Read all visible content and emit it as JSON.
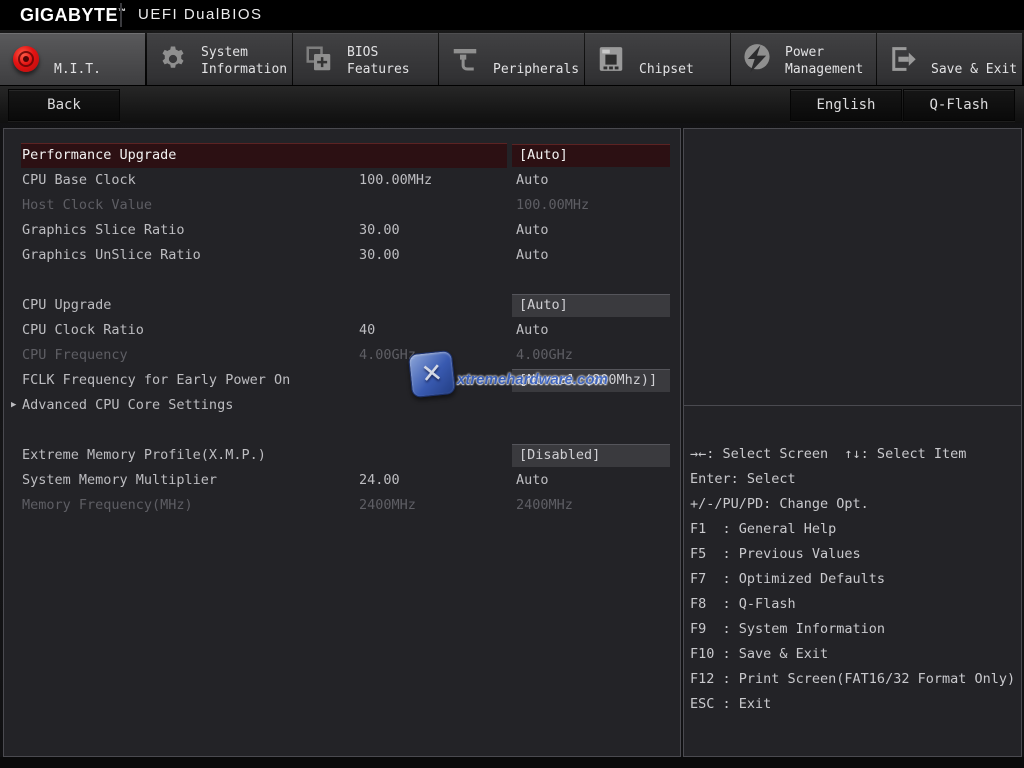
{
  "header": {
    "logo": "GIGABYTE",
    "logo_tm": "™",
    "title": "UEFI DualBIOS"
  },
  "tabs": [
    {
      "label": "M.I.T.",
      "icon": "mit-red-dot-icon",
      "active": true
    },
    {
      "label": "System Information",
      "icon": "gear-icon",
      "active": false
    },
    {
      "label": "BIOS Features",
      "icon": "bios-chip-icon",
      "active": false
    },
    {
      "label": "Peripherals",
      "icon": "peripherals-icon",
      "active": false
    },
    {
      "label": "Chipset",
      "icon": "chipset-icon",
      "active": false
    },
    {
      "label": "Power Management",
      "icon": "power-bolt-icon",
      "active": false
    },
    {
      "label": "Save & Exit",
      "icon": "exit-door-icon",
      "active": false
    }
  ],
  "toolbar": {
    "back": "Back",
    "language": "English",
    "qflash": "Q-Flash"
  },
  "settings": {
    "rows": [
      {
        "label": "Performance Upgrade",
        "col2": "",
        "value": "[Auto]",
        "selected": true,
        "boxed": true
      },
      {
        "label": "CPU Base Clock",
        "col2": "100.00MHz",
        "value": "Auto"
      },
      {
        "label": "Host Clock Value",
        "col2": "",
        "value": "100.00MHz",
        "dim": true
      },
      {
        "label": "Graphics Slice Ratio",
        "col2": "30.00",
        "value": "Auto"
      },
      {
        "label": "Graphics UnSlice Ratio",
        "col2": "30.00",
        "value": "Auto"
      },
      {
        "spacer": true
      },
      {
        "label": "CPU Upgrade",
        "col2": "",
        "value": "[Auto]",
        "boxed": true
      },
      {
        "label": "CPU Clock Ratio",
        "col2": "40",
        "value": "Auto"
      },
      {
        "label": "CPU Frequency",
        "col2": "4.00GHz",
        "value": "4.00GHz",
        "dim": true
      },
      {
        "label": "FCLK Frequency for Early Power On",
        "col2": "",
        "value": "[Normal (800Mhz)]",
        "boxed": true
      },
      {
        "label": "Advanced CPU Core Settings",
        "col2": "",
        "value": "",
        "arrow": true
      },
      {
        "spacer": true
      },
      {
        "label": "Extreme Memory Profile(X.M.P.)",
        "col2": "",
        "value": "[Disabled]",
        "boxed": true
      },
      {
        "label": "System Memory Multiplier",
        "col2": "24.00",
        "value": "Auto"
      },
      {
        "label": "Memory Frequency(MHz)",
        "col2": "2400MHz",
        "value": "2400MHz",
        "dim": true
      }
    ]
  },
  "help": {
    "lines": [
      "→←: Select Screen  ↑↓: Select Item",
      "Enter: Select",
      "+/-/PU/PD: Change Opt.",
      "F1  : General Help",
      "F5  : Previous Values",
      "F7  : Optimized Defaults",
      "F8  : Q-Flash",
      "F9  : System Information",
      "F10 : Save & Exit",
      "F12 : Print Screen(FAT16/32 Format Only)",
      "ESC : Exit"
    ]
  },
  "watermark": {
    "text": "xtremehardware.com",
    "x_glyph": "✕"
  },
  "colors": {
    "accent_red": "#d21111",
    "selected_row_bg": "#2c1013",
    "value_box_bg": "#3a3a3e",
    "panel_bg": "#232327",
    "panel_border": "#4a4a50",
    "watermark_blue": "#3e68cc"
  }
}
